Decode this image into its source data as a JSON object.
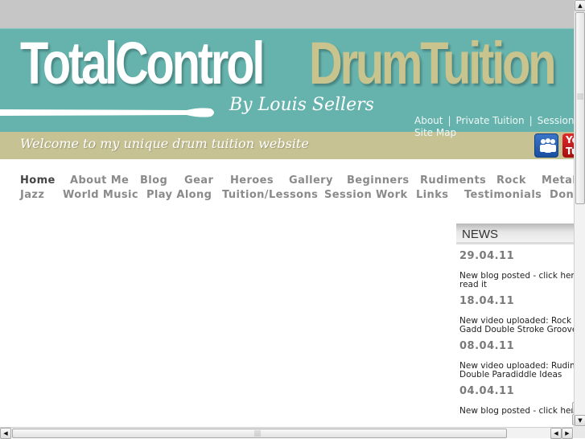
{
  "header": {
    "logo_part1": "TotalControl",
    "logo_part2": "DrumTuition",
    "byline": "By Louis Sellers",
    "welcome": "Welcome to my unique drum tuition website",
    "top_links": [
      "About",
      "Private Tuition",
      "Session"
    ],
    "top_link_sep": "|",
    "sitemap": "Site Map",
    "social": [
      {
        "name": "myspace",
        "label": ""
      },
      {
        "name": "youtube",
        "label": "You Tu"
      }
    ],
    "colors": {
      "teal": "#66b3ad",
      "khaki": "#c6c293",
      "logo_khaki": "#c9c38e"
    }
  },
  "nav": {
    "row1": [
      "Home",
      "About Me",
      "Blog",
      "Gear",
      "Heroes",
      "Gallery",
      "Beginners",
      "Rudiments",
      "Rock",
      "Metal"
    ],
    "row2": [
      "Jazz",
      "World Music",
      "Play Along",
      "Tuition/Lessons",
      "Session Work",
      "Links",
      "Testimonials",
      "Dona"
    ],
    "active": "Home"
  },
  "news": {
    "title": "NEWS",
    "items": [
      {
        "date": "29.04.11",
        "text1": "New blog posted - click here",
        "text2": "read it"
      },
      {
        "date": "18.04.11",
        "text1": "New video uploaded: Rock -",
        "text2": "Gadd Double Stroke Groove"
      },
      {
        "date": "08.04.11",
        "text1": "New video uploaded: Rudim",
        "text2": "Double Paradiddle Ideas"
      },
      {
        "date": "04.04.11",
        "text1": "New blog posted - click here",
        "text2": ""
      }
    ]
  },
  "scrollbars": {
    "up": "▲",
    "down": "▼",
    "left": "◀",
    "right": "▶"
  }
}
